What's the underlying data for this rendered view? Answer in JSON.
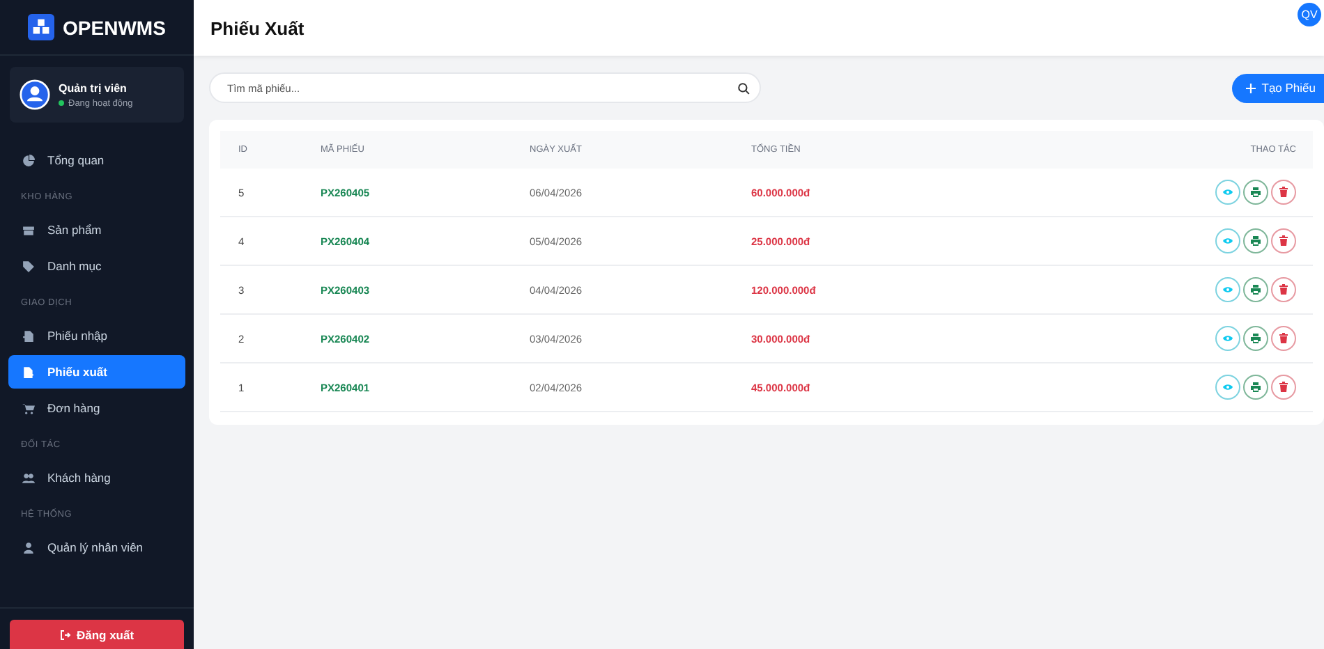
{
  "brand": "OPENWMS",
  "user": {
    "name": "Quản trị viên",
    "status": "Đang hoạt động"
  },
  "nav": [
    {
      "kind": "link",
      "label": "Tổng quan",
      "selected": false
    },
    {
      "kind": "heading",
      "label": "KHO HÀNG"
    },
    {
      "kind": "link",
      "label": "Sản phẩm",
      "selected": false
    },
    {
      "kind": "link",
      "label": "Danh mục",
      "selected": false
    },
    {
      "kind": "heading",
      "label": "GIAO DỊCH"
    },
    {
      "kind": "link",
      "label": "Phiếu nhập",
      "selected": false
    },
    {
      "kind": "link",
      "label": "Phiếu xuất",
      "selected": true
    },
    {
      "kind": "link",
      "label": "Đơn hàng",
      "selected": false
    },
    {
      "kind": "heading",
      "label": "ĐỐI TÁC"
    },
    {
      "kind": "link",
      "label": "Khách hàng",
      "selected": false
    },
    {
      "kind": "heading",
      "label": "HỆ THỐNG"
    },
    {
      "kind": "link",
      "label": "Quản lý nhân viên",
      "selected": false
    }
  ],
  "logout": "Đăng xuất",
  "page_title": "Phiếu Xuất",
  "avatar": "QV",
  "search": {
    "placeholder": "Tìm mã phiếu..."
  },
  "create_button": "Tạo Phiếu",
  "table": {
    "columns": [
      "ID",
      "MÃ PHIẾU",
      "NGÀY XUẤT",
      "TỔNG TIỀN",
      "THAO TÁC"
    ],
    "rows": [
      {
        "id": "5",
        "code": "PX260405",
        "date": "06/04/2026",
        "total": "60.000.000đ"
      },
      {
        "id": "4",
        "code": "PX260404",
        "date": "05/04/2026",
        "total": "25.000.000đ"
      },
      {
        "id": "3",
        "code": "PX260403",
        "date": "04/04/2026",
        "total": "120.000.000đ"
      },
      {
        "id": "2",
        "code": "PX260402",
        "date": "03/04/2026",
        "total": "30.000.000đ"
      },
      {
        "id": "1",
        "code": "PX260401",
        "date": "02/04/2026",
        "total": "45.000.000đ"
      }
    ]
  }
}
